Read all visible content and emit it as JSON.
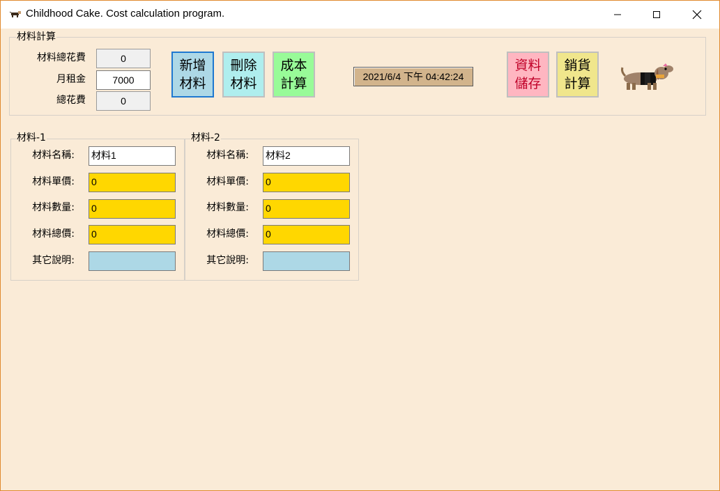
{
  "window": {
    "title": "Childhood Cake. Cost calculation program."
  },
  "summary": {
    "group_title": "材料計算",
    "total_material_label": "材料總花費",
    "total_material_value": "0",
    "rent_label": "月租金",
    "rent_value": "7000",
    "total_label": "總花費",
    "total_value": "0"
  },
  "buttons": {
    "add": "新增\n材料",
    "delete": "刪除\n材料",
    "cost": "成本\n計算",
    "save": "資料\n儲存",
    "sales": "銷貨\n計算"
  },
  "datetime": "2021/6/4 下午 04:42:24",
  "materials": [
    {
      "group_title": "材料-1",
      "name_label": "材料名稱:",
      "name_value": "材料1",
      "price_label": "材料單價:",
      "price_value": "0",
      "qty_label": "材料數量:",
      "qty_value": "0",
      "total_label": "材料總價:",
      "total_value": "0",
      "note_label": "其它說明:",
      "note_value": ""
    },
    {
      "group_title": "材料-2",
      "name_label": "材料名稱:",
      "name_value": "材料2",
      "price_label": "材料單價:",
      "price_value": "0",
      "qty_label": "材料數量:",
      "qty_value": "0",
      "total_label": "材料總價:",
      "total_value": "0",
      "note_label": "其它說明:",
      "note_value": ""
    }
  ],
  "colors": {
    "background": "#faebd7",
    "add_button": "#add8e6",
    "delete_button": "#afeeee",
    "cost_button": "#98fb98",
    "save_button": "#ffb6c1",
    "sales_button": "#f0e68c",
    "input_gold": "#ffd700",
    "input_blue": "#add8e6",
    "date_bg": "#d2b48c"
  },
  "icons": {
    "app": "dachshund-icon",
    "mascot": "dachshund-image"
  }
}
